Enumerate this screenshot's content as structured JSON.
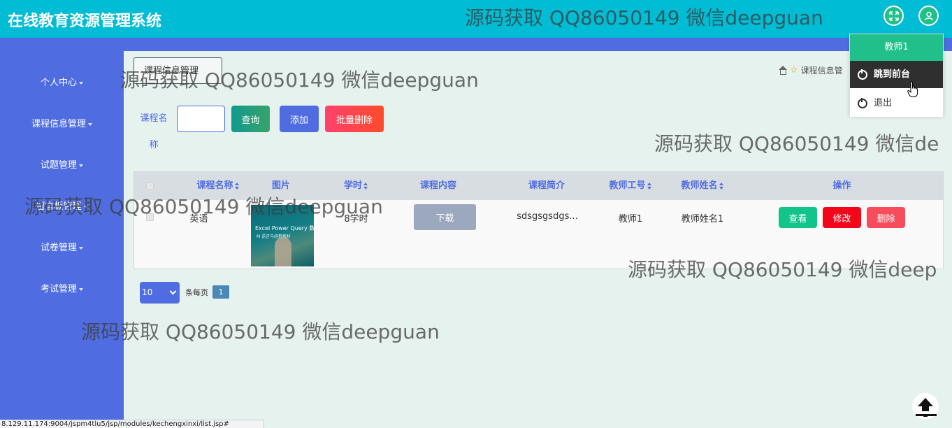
{
  "header": {
    "title": "在线教育资源管理系统"
  },
  "sidebar": {
    "items": [
      {
        "label": "个人中心"
      },
      {
        "label": "课程信息管理"
      },
      {
        "label": "试题管理"
      },
      {
        "label": "留言板管理"
      },
      {
        "label": "试卷管理"
      },
      {
        "label": "考试管理"
      }
    ]
  },
  "page": {
    "tab_label": "课程信息管理",
    "breadcrumb": "课程信息管"
  },
  "search": {
    "label": "课程名称",
    "value": "",
    "query_label": "查询",
    "add_label": "添加",
    "batch_delete_label": "批量删除"
  },
  "table": {
    "headers": [
      "课程名称",
      "图片",
      "学时",
      "课程内容",
      "课程简介",
      "教师工号",
      "教师姓名",
      "操作"
    ],
    "rows": [
      {
        "name": "英语",
        "image_title": "Excel Power Query 数据",
        "image_sub": "M 语言与函数解析",
        "hours": "8学时",
        "content_button": "下载",
        "summary": "sdsgsgsdgs...",
        "teacher_id": "教师1",
        "teacher_name": "教师姓名1",
        "view_label": "查看",
        "edit_label": "修改",
        "delete_label": "删除"
      }
    ]
  },
  "pagination": {
    "page_size": "10",
    "per_page_label": "条每页",
    "current_page": "1"
  },
  "user_menu": {
    "username": "教师1",
    "front_label": "跳到前台",
    "exit_label": "退出"
  },
  "statusbar": {
    "url": "8.129.11.174:9004/jspm4tlu5/jsp/modules/kechengxinxi/list.jsp#"
  },
  "watermarks": {
    "w1": "源码获取 QQ86050149 微信deepguan",
    "w2": "源码获取 QQ86050149 微信deepguan",
    "w3": "源码获取 QQ86050149 微信de",
    "w4": "源码获取 QQ86050149 微信deepguan",
    "w5": "源码获取 QQ86050149 微信deep",
    "w6": "源码获取 QQ86050149 微信deepguan"
  },
  "colors": {
    "topbar": "#00bcd4",
    "sidebar": "#4f6de0",
    "accent_green": "#21c08a",
    "danger": "#f0081a"
  }
}
